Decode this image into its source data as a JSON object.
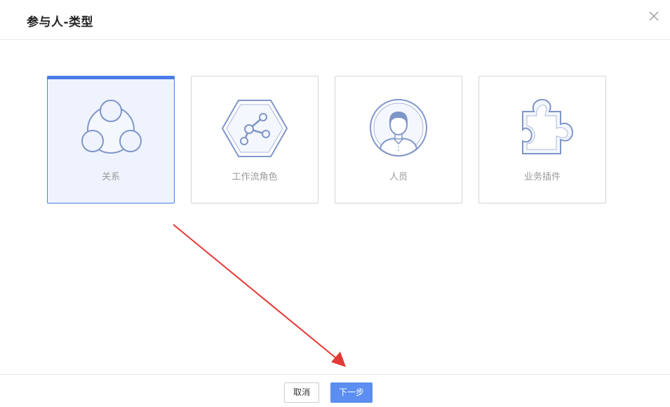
{
  "dialog": {
    "title": "参与人-类型"
  },
  "types": [
    {
      "label": "关系",
      "icon": "relation-icon",
      "selected": true
    },
    {
      "label": "工作流角色",
      "icon": "workflow-role-icon",
      "selected": false
    },
    {
      "label": "人员",
      "icon": "person-icon",
      "selected": false
    },
    {
      "label": "业务插件",
      "icon": "puzzle-plugin-icon",
      "selected": false
    }
  ],
  "footer": {
    "cancel_label": "取消",
    "next_label": "下一步"
  },
  "colors": {
    "accent": "#4a7de8",
    "button_primary": "#5b8ef0",
    "icon_stroke": "#7f96c8",
    "annotation_arrow": "#e53935"
  }
}
